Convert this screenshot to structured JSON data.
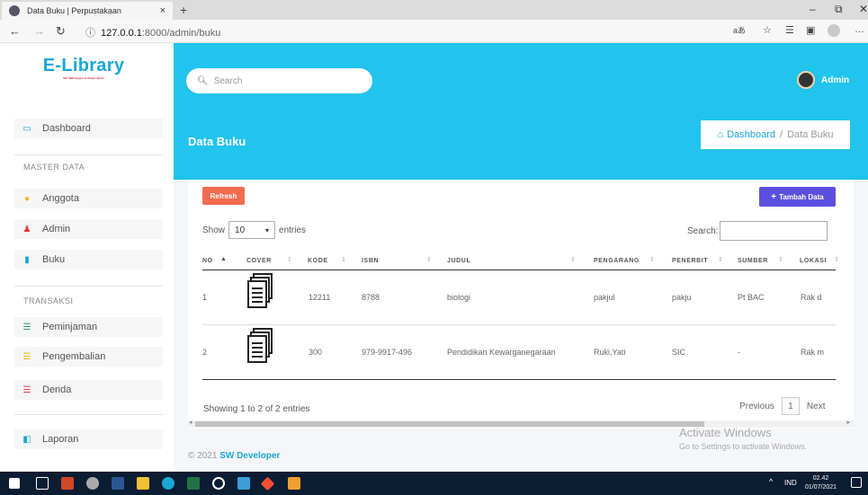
{
  "browser": {
    "tab_title": "Data Buku | Perpustakaan",
    "tab_close": "×",
    "new_tab": "+",
    "url_host": "127.0.0.1",
    "url_path": ":8000/admin/buku",
    "info_icon": "ⓘ"
  },
  "sidebar": {
    "logo": "E-Library",
    "logo_sub": "SIP SMP Negeri 11 Muara Jambi",
    "dashboard": "Dashboard",
    "section_master": "MASTER DATA",
    "anggota": "Anggota",
    "admin": "Admin",
    "buku": "Buku",
    "section_transaksi": "TRANSAKSI",
    "peminjaman": "Peminjaman",
    "pengembalian": "Pengembalian",
    "denda": "Denda",
    "laporan": "Laporan"
  },
  "header": {
    "search_placeholder": "Search",
    "user_name": "Admin",
    "page_title": "Data Buku",
    "breadcrumb_home": "Dashboard",
    "breadcrumb_sep": "/",
    "breadcrumb_current": "Data Buku"
  },
  "toolbar": {
    "refresh_label": "Refresh",
    "add_label": "Tambah Data",
    "show_label": "Show",
    "entries_value": "10",
    "entries_label": "entries",
    "search_label": "Search:"
  },
  "table": {
    "columns": [
      "NO",
      "COVER",
      "KODE",
      "ISBN",
      "JUDUL",
      "PENGARANG",
      "PENERBIT",
      "SUMBER",
      "LOKASI"
    ],
    "rows": [
      {
        "no": "1",
        "kode": "12211",
        "isbn": "8788",
        "judul": "biologi",
        "pengarang": "pakjul",
        "penerbit": "pakju",
        "sumber": "Pt BAC",
        "lokasi": "Rak d"
      },
      {
        "no": "2",
        "kode": "300",
        "isbn": "979-9917-496",
        "judul": "Pendidikan Kewarganegaraan",
        "pengarang": "Ruki,Yati",
        "penerbit": "SIC",
        "sumber": "-",
        "lokasi": "Rak m"
      }
    ]
  },
  "pagination": {
    "info": "Showing 1 to 2 of 2 entries",
    "previous": "Previous",
    "current": "1",
    "next": "Next"
  },
  "footer": {
    "copyright": "© 2021",
    "developer": "SW Developer"
  },
  "watermark": {
    "line1": "Activate Windows",
    "line2": "Go to Settings to activate Windows."
  },
  "taskbar": {
    "lang": "IND",
    "time": "02.42",
    "date": "01/07/2021"
  },
  "colors": {
    "accent": "#21c4ec",
    "refresh": "#f26c4f",
    "add": "#5b4fe0"
  }
}
